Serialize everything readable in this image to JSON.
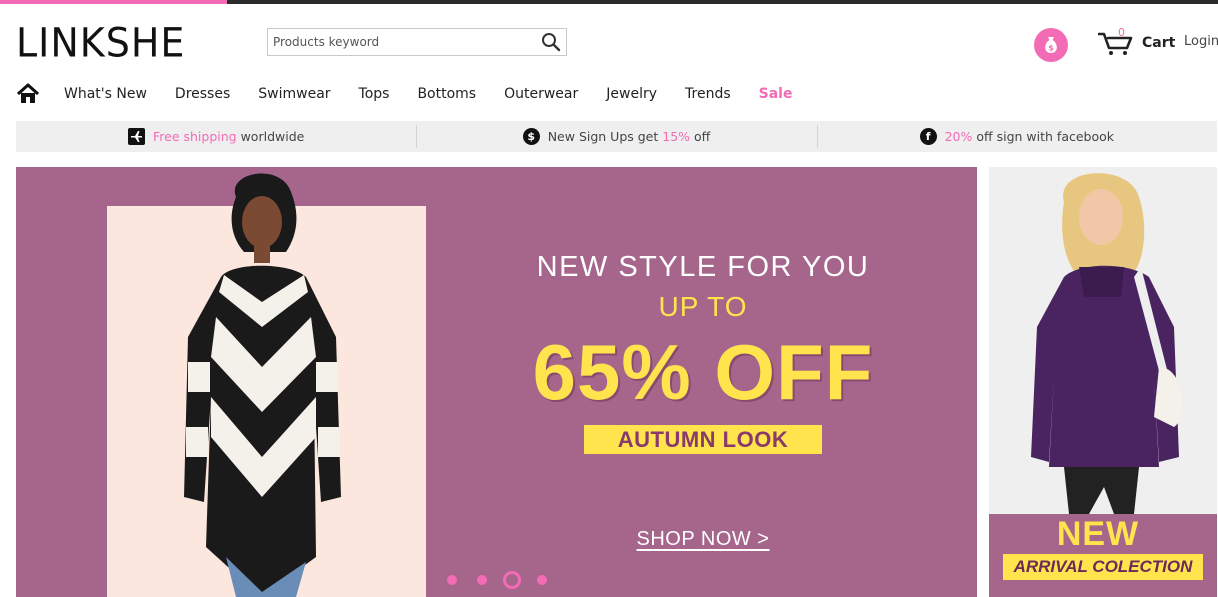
{
  "brand": {
    "logo_text": "LINKSHE",
    "accent_color": "#f36bb5",
    "banner_color": "#a6668c",
    "highlight_color": "#ffe44d"
  },
  "search": {
    "placeholder": "Products keyword",
    "icon": "search-icon"
  },
  "header": {
    "money_icon": "money-bag-icon",
    "cart_count": "0",
    "cart_label": "Cart",
    "login_label": "Login"
  },
  "nav": {
    "home_icon": "home-icon",
    "items": [
      {
        "label": "What's New"
      },
      {
        "label": "Dresses"
      },
      {
        "label": "Swimwear"
      },
      {
        "label": "Tops"
      },
      {
        "label": "Bottoms"
      },
      {
        "label": "Outerwear"
      },
      {
        "label": "Jewelry"
      },
      {
        "label": "Trends"
      },
      {
        "label": "Sale"
      }
    ]
  },
  "benefits": [
    {
      "icon": "airplane-icon",
      "highlight": "Free shipping",
      "text": " worldwide"
    },
    {
      "icon": "dollar-icon",
      "text_before": "New Sign Ups get ",
      "highlight": "15%",
      "text_after": " off"
    },
    {
      "icon": "facebook-icon",
      "highlight": "20%",
      "text": " off sign with facebook"
    }
  ],
  "hero": {
    "line1": "NEW STYLE FOR YOU",
    "line2": "UP TO",
    "line3": "65% OFF",
    "tag": "AUTUMN LOOK",
    "cta": "SHOP NOW >",
    "slide_count": 4,
    "active_slide": 3
  },
  "side_banner": {
    "title": "NEW",
    "subtitle": "ARRIVAL COLECTION"
  }
}
